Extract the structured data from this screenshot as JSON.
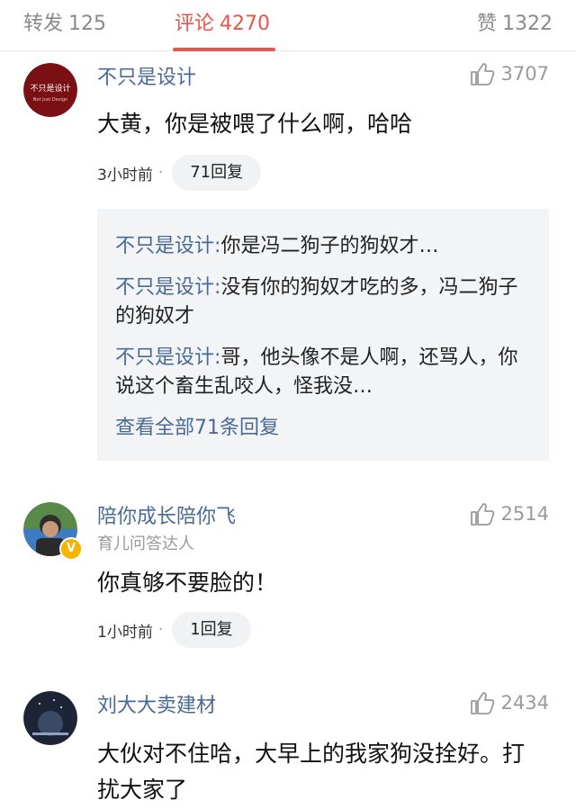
{
  "tabs": {
    "repost": {
      "label": "转发",
      "count": "125"
    },
    "comment": {
      "label": "评论",
      "count": "4270"
    },
    "like": {
      "label": "赞",
      "count": "1322"
    }
  },
  "colors": {
    "accent": "#e8554e",
    "username": "#4a6a96",
    "muted": "#9a9a9a",
    "reply_bg": "#f3f4f6",
    "badge": "#f4b400"
  },
  "comments": [
    {
      "username": "不只是设计",
      "avatar_text": "不只是设计",
      "avatar_subtext": "Not Just Design",
      "likes": "3707",
      "text": "大黄，你是被喂了什么啊，哈哈",
      "time": "3小时前",
      "dot": "·",
      "replies": "71回复",
      "reply_preview": [
        {
          "name": "不只是设计",
          "colon": ":",
          "text": "你是冯二狗子的狗奴才…"
        },
        {
          "name": "不只是设计",
          "colon": ":",
          "text": "没有你的狗奴才吃的多，冯二狗子的狗奴才"
        },
        {
          "name": "不只是设计",
          "colon": ":",
          "text": "哥，他头像不是人啊，还骂人，你说这个畜生乱咬人，怪我没…"
        }
      ],
      "see_all": "查看全部71条回复"
    },
    {
      "username": "陪你成长陪你飞",
      "subtitle": "育儿问答达人",
      "badge": "V",
      "likes": "2514",
      "text": "你真够不要脸的！",
      "time": "1小时前",
      "dot": "·",
      "replies": "1回复"
    },
    {
      "username": "刘大大卖建材",
      "likes": "2434",
      "text": "大伙对不住哈，大早上的我家狗没拴好。打扰大家了"
    }
  ],
  "icons": {
    "like": "thumbs-up-icon",
    "badge": "verified-badge-icon"
  }
}
